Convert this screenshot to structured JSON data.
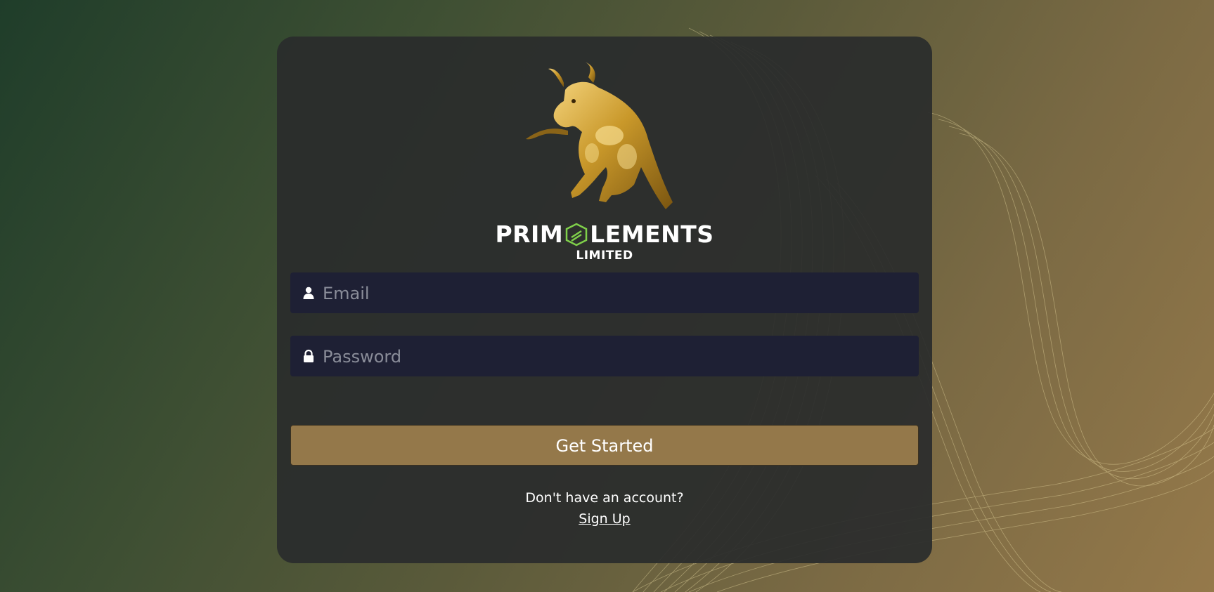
{
  "brand": {
    "name_left": "PRIM",
    "name_right": "LEMENTS",
    "subtitle": "LIMITED"
  },
  "form": {
    "email": {
      "placeholder": "Email",
      "icon": "user-icon"
    },
    "password": {
      "placeholder": "Password",
      "icon": "lock-icon"
    },
    "submit_label": "Get Started"
  },
  "footer": {
    "prompt": "Don't have an account?",
    "signup_label": "Sign Up"
  },
  "colors": {
    "button": "#94784a",
    "field_bg": "#1e2034",
    "brand_mark": "#7fd04a",
    "logo_gold": "#c9982a"
  }
}
